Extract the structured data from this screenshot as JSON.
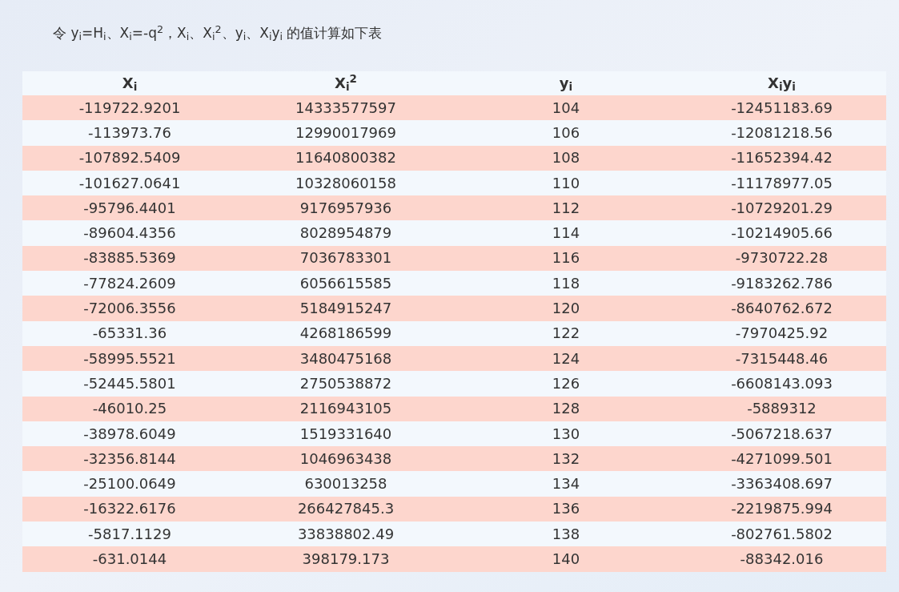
{
  "heading": "令 y$_{i}$=H$_{i}$、X$_{i}$=-q$^{2}$，X$_{i}$、X$_{i}$$^{2}$、y$_{i}$、X$_{i}$y$_{i}$ 的值计算如下表",
  "table": {
    "columns": [
      "X$_{i}$",
      "X$_{i}$$^{2}$",
      "y$_{i}$",
      "X$_{i}$y$_{i}$"
    ],
    "rows": [
      [
        "-119722.9201",
        "14333577597",
        "104",
        "-12451183.69"
      ],
      [
        "-113973.76",
        "12990017969",
        "106",
        "-12081218.56"
      ],
      [
        "-107892.5409",
        "11640800382",
        "108",
        "-11652394.42"
      ],
      [
        "-101627.0641",
        "10328060158",
        "110",
        "-11178977.05"
      ],
      [
        "-95796.4401",
        "9176957936",
        "112",
        "-10729201.29"
      ],
      [
        "-89604.4356",
        "8028954879",
        "114",
        "-10214905.66"
      ],
      [
        "-83885.5369",
        "7036783301",
        "116",
        "-9730722.28"
      ],
      [
        "-77824.2609",
        "6056615585",
        "118",
        "-9183262.786"
      ],
      [
        "-72006.3556",
        "5184915247",
        "120",
        "-8640762.672"
      ],
      [
        "-65331.36",
        "4268186599",
        "122",
        "-7970425.92"
      ],
      [
        "-58995.5521",
        "3480475168",
        "124",
        "-7315448.46"
      ],
      [
        "-52445.5801",
        "2750538872",
        "126",
        "-6608143.093"
      ],
      [
        "-46010.25",
        "2116943105",
        "128",
        "-5889312"
      ],
      [
        "-38978.6049",
        "1519331640",
        "130",
        "-5067218.637"
      ],
      [
        "-32356.8144",
        "1046963438",
        "132",
        "-4271099.501"
      ],
      [
        "-25100.0649",
        "630013258",
        "134",
        "-3363408.697"
      ],
      [
        "-16322.6176",
        "266427845.3",
        "136",
        "-2219875.994"
      ],
      [
        "-5817.1129",
        "33838802.49",
        "138",
        "-802761.5802"
      ],
      [
        "-631.0144",
        "398179.173",
        "140",
        "-88342.016"
      ]
    ]
  }
}
